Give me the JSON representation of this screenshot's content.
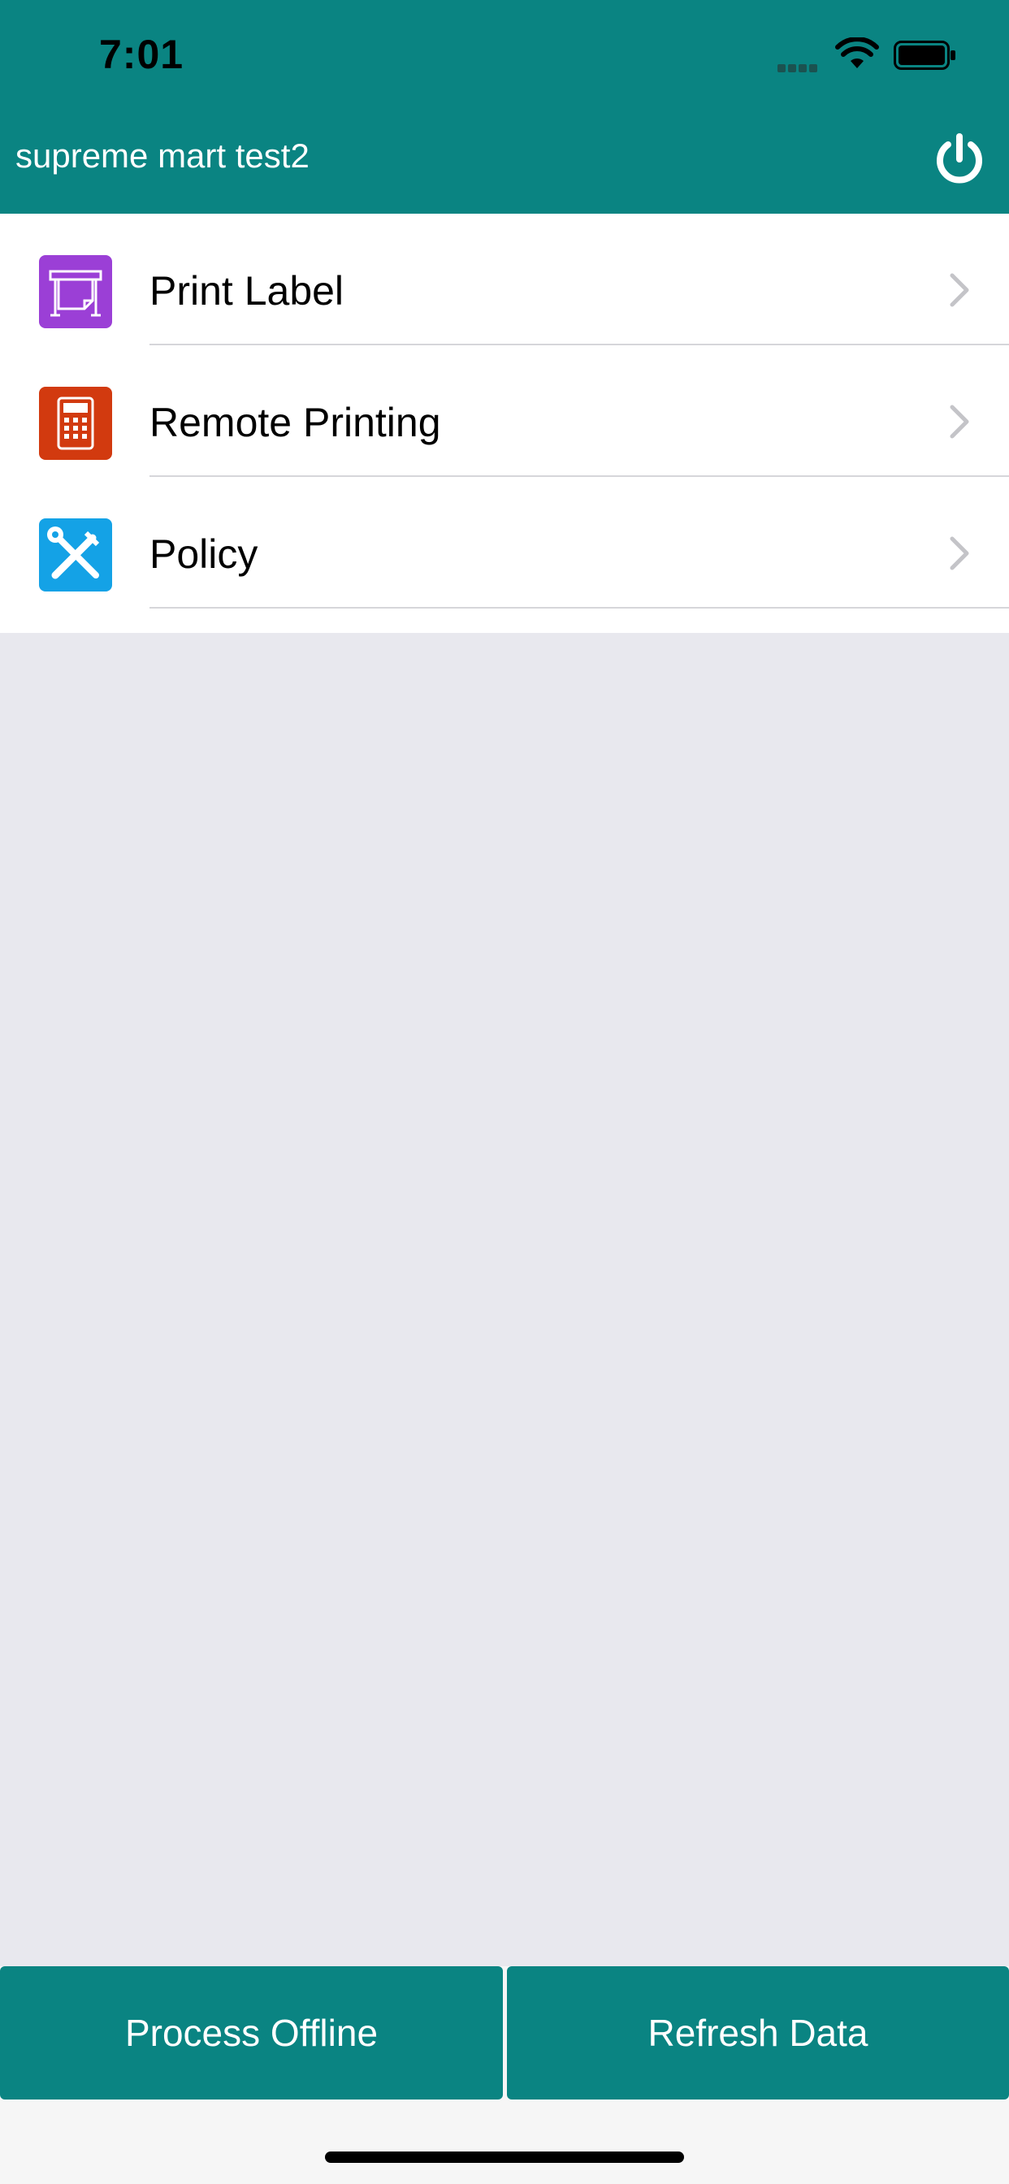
{
  "status_bar": {
    "time": "7:01"
  },
  "header": {
    "title": "supreme mart test2",
    "power_icon": "power-icon"
  },
  "menu": {
    "items": [
      {
        "label": "Print Label",
        "icon": "printer-icon",
        "color": "#9b3fd6"
      },
      {
        "label": "Remote Printing",
        "icon": "calculator-icon",
        "color": "#d23a0f"
      },
      {
        "label": "Policy",
        "icon": "tools-icon",
        "color": "#14a2e6"
      }
    ]
  },
  "footer": {
    "process_offline_label": "Process Offline",
    "refresh_data_label": "Refresh Data"
  },
  "colors": {
    "accent": "#0a8482",
    "background": "#e8e8ee"
  }
}
